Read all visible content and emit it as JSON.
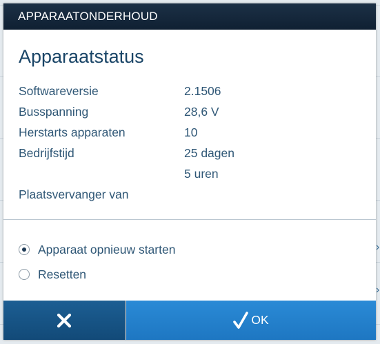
{
  "dialog": {
    "title": "APPARAATONDERHOUD",
    "section_title": "Apparaatstatus"
  },
  "status_rows": [
    {
      "label": "Softwareversie",
      "value": "2.1506"
    },
    {
      "label": "Busspanning",
      "value": "28,6 V"
    },
    {
      "label": "Herstarts apparaten",
      "value": "10"
    },
    {
      "label": "Bedrijfstijd",
      "value": "25 dagen"
    },
    {
      "label": "",
      "value": "5 uren"
    },
    {
      "label": "Plaatsvervanger van",
      "value": ""
    }
  ],
  "options": [
    {
      "label": "Apparaat opnieuw starten",
      "selected": true
    },
    {
      "label": "Resetten",
      "selected": false
    }
  ],
  "buttons": {
    "cancel_icon": "close-icon",
    "ok_icon": "checkmark-icon",
    "ok_label": "OK"
  },
  "colors": {
    "header_bg": "#152a3f",
    "text": "#2f5776",
    "title": "#1a4567",
    "cancel_bg": "#1a5688",
    "ok_bg": "#2381cc"
  }
}
